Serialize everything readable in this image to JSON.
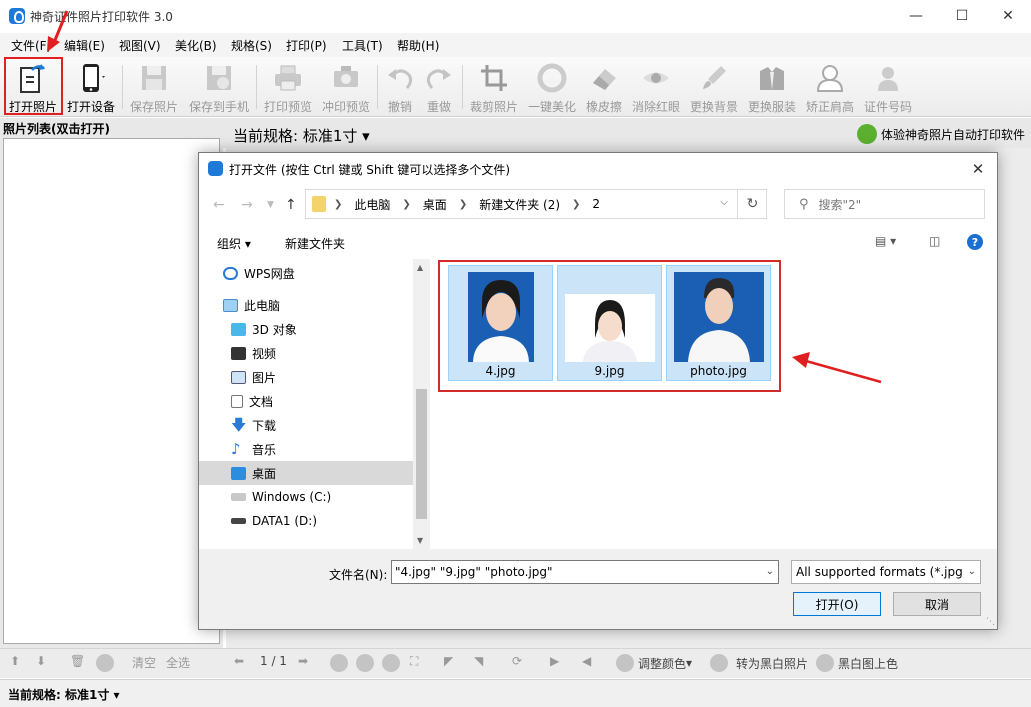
{
  "app": {
    "title": "神奇证件照片打印软件 3.0"
  },
  "menu": [
    "文件(F)",
    "编辑(E)",
    "视图(V)",
    "美化(B)",
    "规格(S)",
    "打印(P)",
    "工具(T)",
    "帮助(H)"
  ],
  "toolbar": {
    "open_photo": "打开照片",
    "open_device": "打开设备",
    "save_photo": "保存照片",
    "save_to_phone": "保存到手机",
    "print_preview": "打印预览",
    "develop_preview": "冲印预览",
    "undo": "撤销",
    "redo": "重做",
    "crop": "裁剪照片",
    "one_click_beautify": "一键美化",
    "eraser": "橡皮擦",
    "remove_red_eye": "消除红眼",
    "change_background": "更换背景",
    "change_clothes": "更换服装",
    "correct_shoulders": "矫正肩高",
    "id_number": "证件号码"
  },
  "left_panel": {
    "header": "照片列表(双击打开)"
  },
  "spec_bar": {
    "label": "当前规格:  标准1寸",
    "auto_print": "体验神奇照片自动打印软件"
  },
  "bottom_bar": {
    "clear": "清空",
    "select_all": "全选",
    "page": "1 / 1",
    "adjust_color": "调整颜色",
    "to_bw": "转为黑白照片",
    "bw_colorize": "黑白图上色"
  },
  "status": {
    "text": "当前规格:  标准1寸"
  },
  "dialog": {
    "title": "打开文件 (按住 Ctrl 键或 Shift 键可以选择多个文件)",
    "breadcrumb": [
      "此电脑",
      "桌面",
      "新建文件夹 (2)",
      "2"
    ],
    "search_placeholder": "搜索\"2\"",
    "organize": "组织",
    "new_folder": "新建文件夹",
    "tree": [
      {
        "label": "WPS网盘"
      },
      {
        "label": "此电脑"
      },
      {
        "label": "3D 对象"
      },
      {
        "label": "视频"
      },
      {
        "label": "图片"
      },
      {
        "label": "文档"
      },
      {
        "label": "下载"
      },
      {
        "label": "音乐"
      },
      {
        "label": "桌面"
      },
      {
        "label": "Windows (C:)"
      },
      {
        "label": "DATA1 (D:)"
      }
    ],
    "files": [
      {
        "name": "4.jpg"
      },
      {
        "name": "9.jpg"
      },
      {
        "name": "photo.jpg"
      }
    ],
    "filename_label": "文件名(N):",
    "filename_value": "\"4.jpg\" \"9.jpg\" \"photo.jpg\"",
    "filetype": "All supported formats (*.jpg",
    "open_button": "打开(O)",
    "cancel_button": "取消"
  },
  "colors": {
    "accent": "#1e7ad6",
    "highlight": "#e02020",
    "selection": "#cce4f7",
    "photo_blue": "#1b5fb5"
  }
}
